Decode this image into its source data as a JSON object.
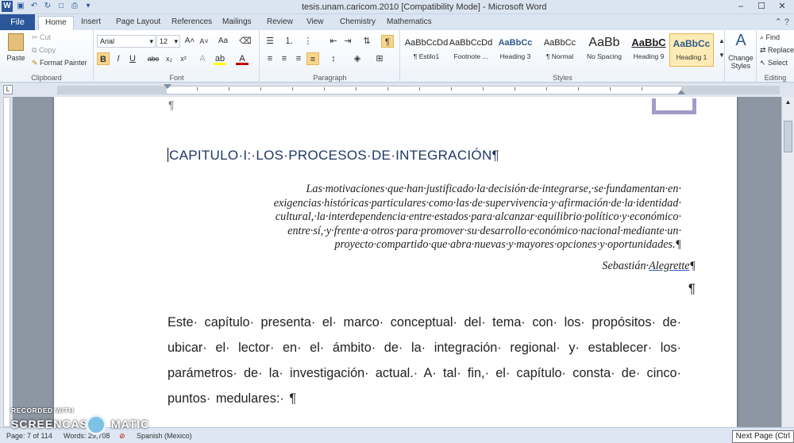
{
  "window": {
    "title": "tesis.unam.caricom.2010 [Compatibility Mode]  -  Microsoft Word",
    "controls": [
      "–",
      "☐",
      "✕"
    ]
  },
  "tabs": {
    "file": "File",
    "items": [
      "Home",
      "Insert",
      "Page Layout",
      "References",
      "Mailings",
      "Review",
      "View",
      "Chemistry",
      "Mathematics"
    ],
    "active": "Home"
  },
  "ribbon": {
    "clipboard": {
      "label": "Clipboard",
      "paste": "Paste",
      "cut": "Cut",
      "copy": "Copy",
      "format_painter": "Format Painter"
    },
    "font": {
      "label": "Font",
      "name": "Arial",
      "size": "12"
    },
    "paragraph": {
      "label": "Paragraph"
    },
    "styles": {
      "label": "Styles",
      "items": [
        {
          "preview": "AaBbCcDd",
          "name": "¶ Estilo1"
        },
        {
          "preview": "AaBbCcDd",
          "name": "Footnote ..."
        },
        {
          "preview": "AaBbCc",
          "name": "Heading 3"
        },
        {
          "preview": "AaBbCc",
          "name": "¶ Normal"
        },
        {
          "preview": "AaBb",
          "name": "No Spacing"
        },
        {
          "preview": "AaBbC",
          "name": "Heading 9"
        },
        {
          "preview": "AaBbCc",
          "name": "Heading 1"
        }
      ],
      "change_styles": "Change Styles"
    },
    "editing": {
      "label": "Editing",
      "find": "Find",
      "replace": "Replace",
      "select": "Select"
    }
  },
  "document": {
    "heading": "CAPITULO·I:·LOS·PROCESOS·DE·INTEGRACIÓN¶",
    "quote": "Las·motivaciones·que·han·justificado·la·decisión·de·integrarse,·se·fundamentan·en· exigencias·históricas·particulares·como·las·de·supervivencia·y·afirmación·de·la·identidad· cultural,·la·interdependencia·entre·estados·para·alcanzar·equilibrio·político·y·económico· entre·sí,·y·frente·a·otros·para·promover·su·desarrollo·económico·nacional·mediante·un· proyecto·compartido·que·abra·nuevas·y·mayores·opciones·y·oportunidades.¶",
    "author_first": "Sebastián·",
    "author_last": "Alegrette",
    "author_mark": "¶",
    "empty_mark": "¶",
    "body": "Este· capítulo· presenta· el· marco· conceptual· del· tema· con· los· propósitos· de· ubicar· el· lector· en· el· ámbito· de· la· integración· regional· y· establecer· los· parámetros· de· la· investigación· actual.· A· tal· fin,· el· capítulo· consta· de· cinco· puntos· medulares:· ¶"
  },
  "status": {
    "page": "Page: 7 of 114",
    "words": "Words: 29,708",
    "language": "Spanish (Mexico)",
    "tooltip": "Next Page (Ctrl"
  },
  "watermark": {
    "top": "RECORDED WITH",
    "left": "SCREENCAST",
    "right": "MATIC"
  }
}
